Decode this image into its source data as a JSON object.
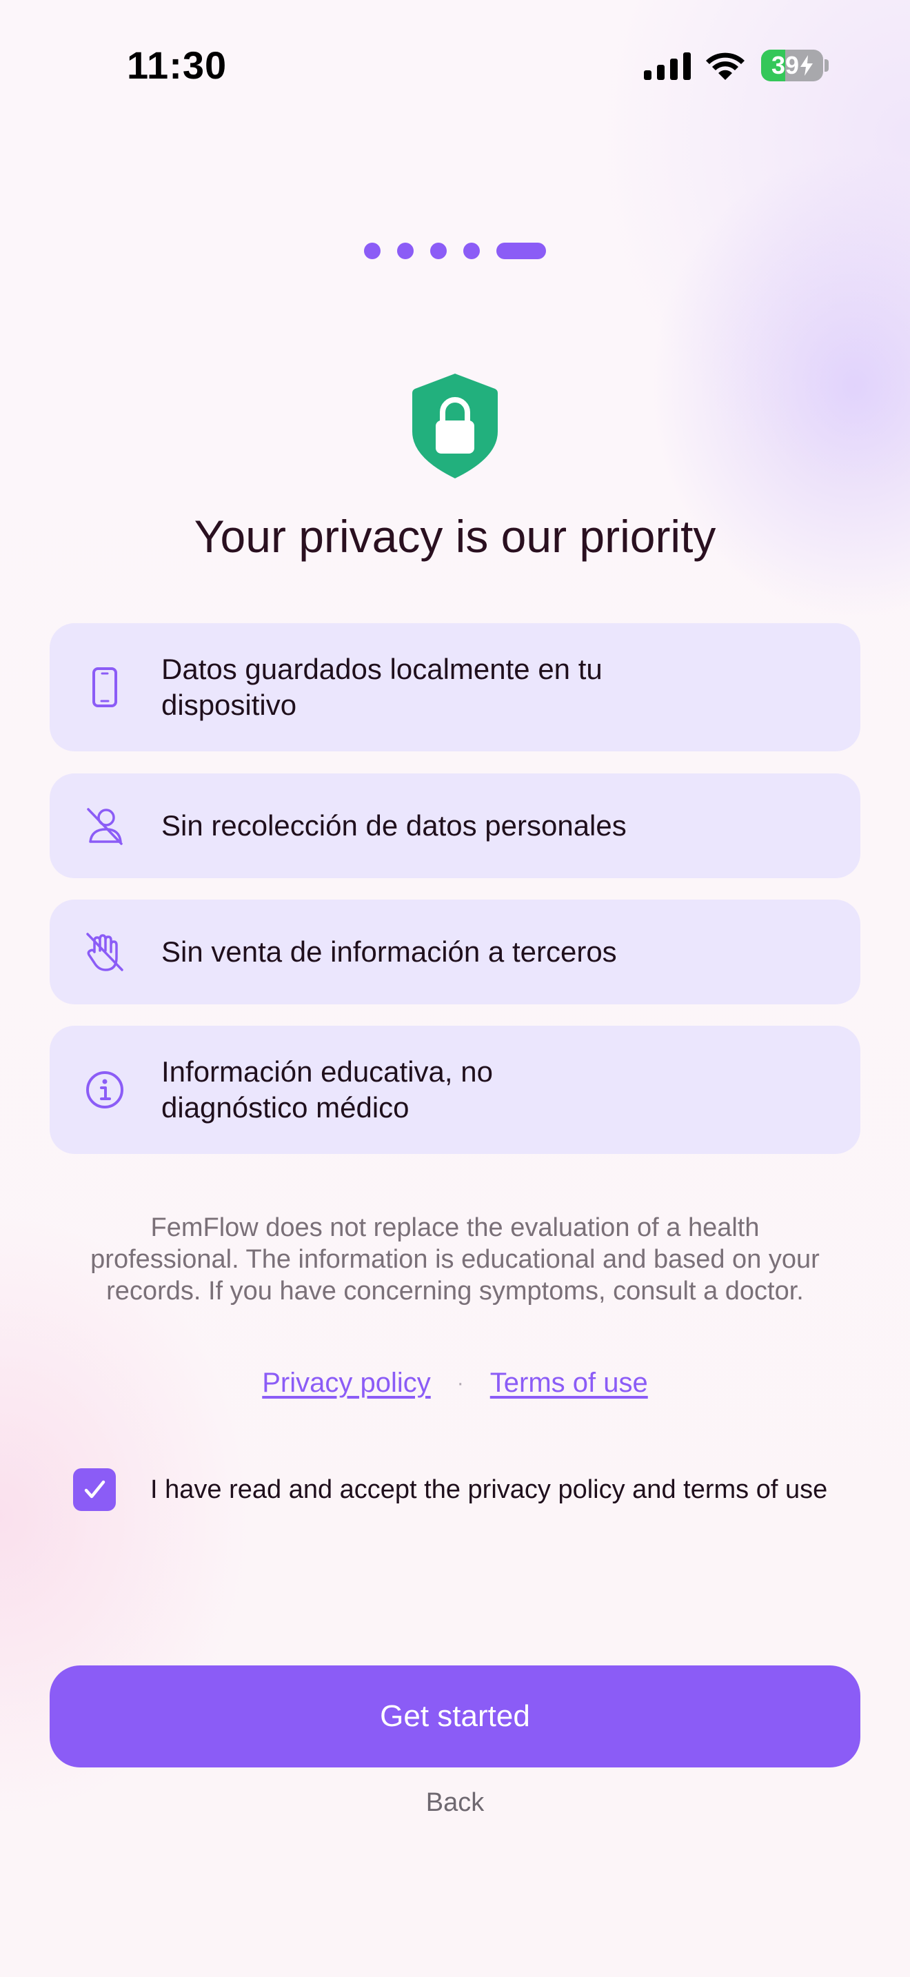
{
  "status_bar": {
    "time": "11:30",
    "battery_level": "39",
    "battery_fraction": 0.39,
    "icons": [
      "cellular-signal-icon",
      "wifi-icon",
      "battery-charging-icon"
    ]
  },
  "onboarding": {
    "step_current": 5,
    "step_total": 5
  },
  "header": {
    "icon": "shield-lock-icon",
    "title": "Your privacy is our priority"
  },
  "features": [
    {
      "icon": "smartphone-icon",
      "line1": "Datos guardados localmente en tu",
      "line2": "dispositivo"
    },
    {
      "icon": "user-off-icon",
      "line1": "Sin recolección de datos personales",
      "line2": ""
    },
    {
      "icon": "hand-off-icon",
      "line1": "Sin venta de información a terceros",
      "line2": ""
    },
    {
      "icon": "info-icon",
      "line1": "Información educativa, no",
      "line2": "diagnóstico médico"
    }
  ],
  "disclaimer": {
    "line1": "FemFlow does not replace the evaluation of a health",
    "line2": "professional. The information is educational and based on your",
    "line3": "records. If you have concerning symptoms, consult a doctor."
  },
  "links": {
    "privacy_policy": "Privacy policy",
    "separator": "·",
    "terms_of_use": "Terms of use"
  },
  "consent": {
    "checked": true,
    "label": "I have read and accept the privacy policy and terms of use"
  },
  "actions": {
    "primary": "Get started",
    "secondary": "Back"
  },
  "colors": {
    "accent": "#8b5cf6",
    "card_background": "#ebe6fd",
    "shield_green": "#22b07d",
    "text_primary": "#2a1020",
    "text_muted": "#7a7078"
  }
}
